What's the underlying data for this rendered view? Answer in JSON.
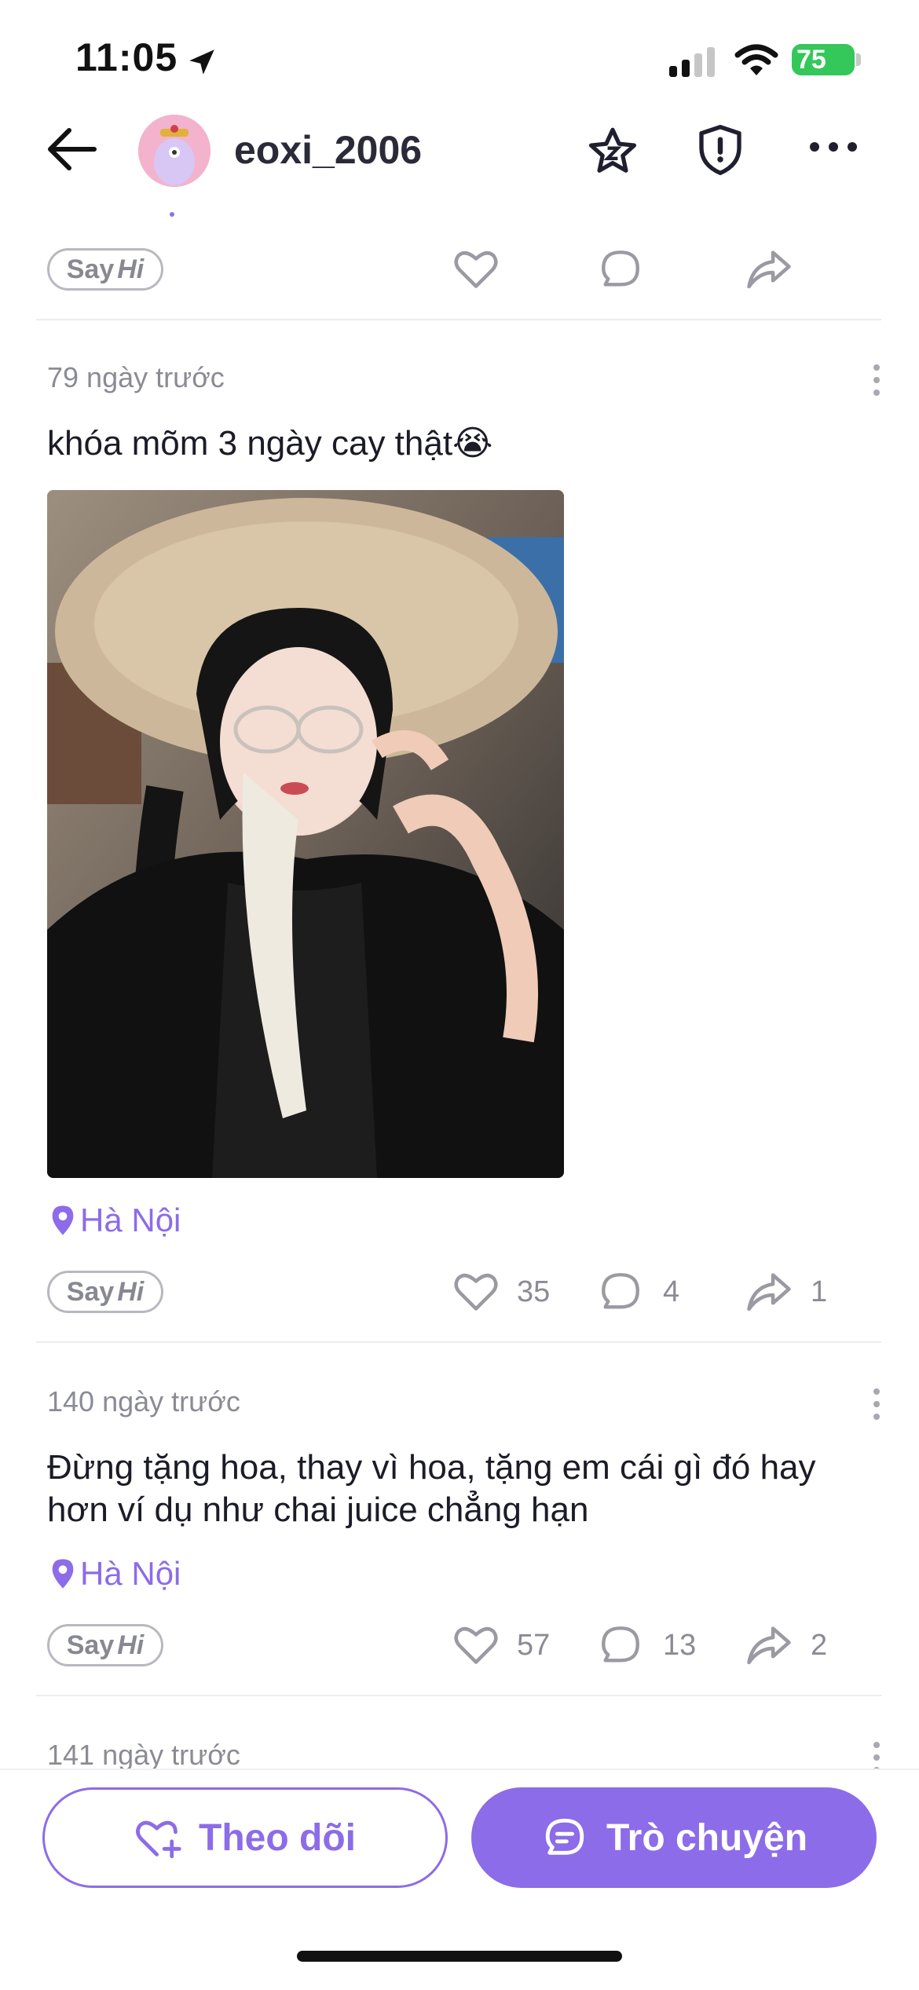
{
  "status_bar": {
    "time": "11:05",
    "battery": "75"
  },
  "header": {
    "username": "eoxi_2006"
  },
  "posts": [
    {
      "say_hi": "Say",
      "say_hi_em": "Hi"
    },
    {
      "time": "79 ngày trước",
      "text": "khóa mõm 3 ngày cay thật😭",
      "location": "Hà Nội",
      "say_hi": "Say",
      "say_hi_em": "Hi",
      "likes": "35",
      "comments": "4",
      "shares": "1"
    },
    {
      "time": "140 ngày trước",
      "text_line1": "Đừng tặng hoa, thay vì hoa, tặng em cái gì đó hay",
      "text_line2": "hơn ví dụ như chai juice chẳng hạn",
      "location": "Hà Nội",
      "say_hi": "Say",
      "say_hi_em": "Hi",
      "likes": "57",
      "comments": "13",
      "shares": "2"
    },
    {
      "time": "141 ngày trước"
    }
  ],
  "bottom": {
    "follow_label": "Theo dõi",
    "chat_label": "Trò chuyện"
  },
  "colors": {
    "accent": "#8c6ce8",
    "battery": "#34c759"
  },
  "icons": [
    "location-arrow-icon",
    "signal-icon",
    "wifi-icon",
    "battery-icon",
    "back-arrow-icon",
    "star-icon",
    "shield-icon",
    "more-icon",
    "heart-icon",
    "comment-icon",
    "share-icon",
    "location-pin-icon",
    "heart-plus-icon",
    "chat-bubble-icon"
  ]
}
